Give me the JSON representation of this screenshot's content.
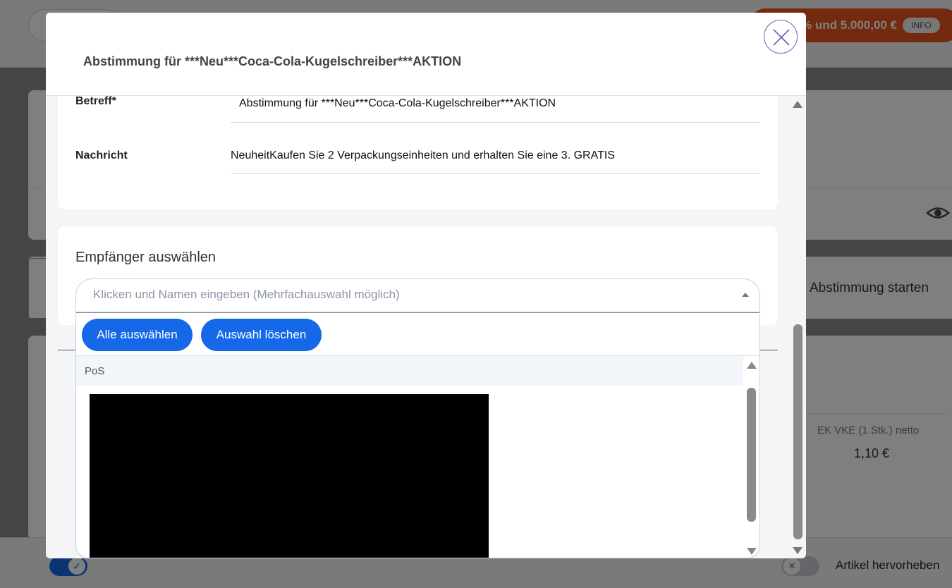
{
  "background": {
    "promo_text": "% und 5.000,00 €",
    "promo_badge": "INFO",
    "start_vote_label": "Abstimmung starten",
    "ek_label": "EK VKE (1 Stk.) netto",
    "ek_value": "1,10 €",
    "highlight_label": "Artikel hervorheben",
    "toggle_on_icon": "check-icon",
    "toggle_off_icon": "x-icon"
  },
  "modal": {
    "title": "Abstimmung für ***Neu***Coca-Cola-Kugelschreiber***AKTION",
    "close_icon": "close-icon",
    "subject_label": "Betreff*",
    "subject_value": "Abstimmung für ***Neu***Coca-Cola-Kugelschreiber***AKTION",
    "message_label": "Nachricht",
    "message_value": "NeuheitKaufen Sie 2 Verpackungseinheiten und erhalten Sie eine 3. GRATIS",
    "recipients_title": "Empfänger auswählen",
    "recipients_placeholder": "Klicken und Namen eingeben (Mehrfachauswahl möglich)",
    "select_all_label": "Alle auswählen",
    "clear_selection_label": "Auswahl löschen",
    "group_label": "PoS"
  },
  "colors": {
    "primary": "#1568e8",
    "promo": "#e8541d",
    "redacted": "#000000"
  }
}
